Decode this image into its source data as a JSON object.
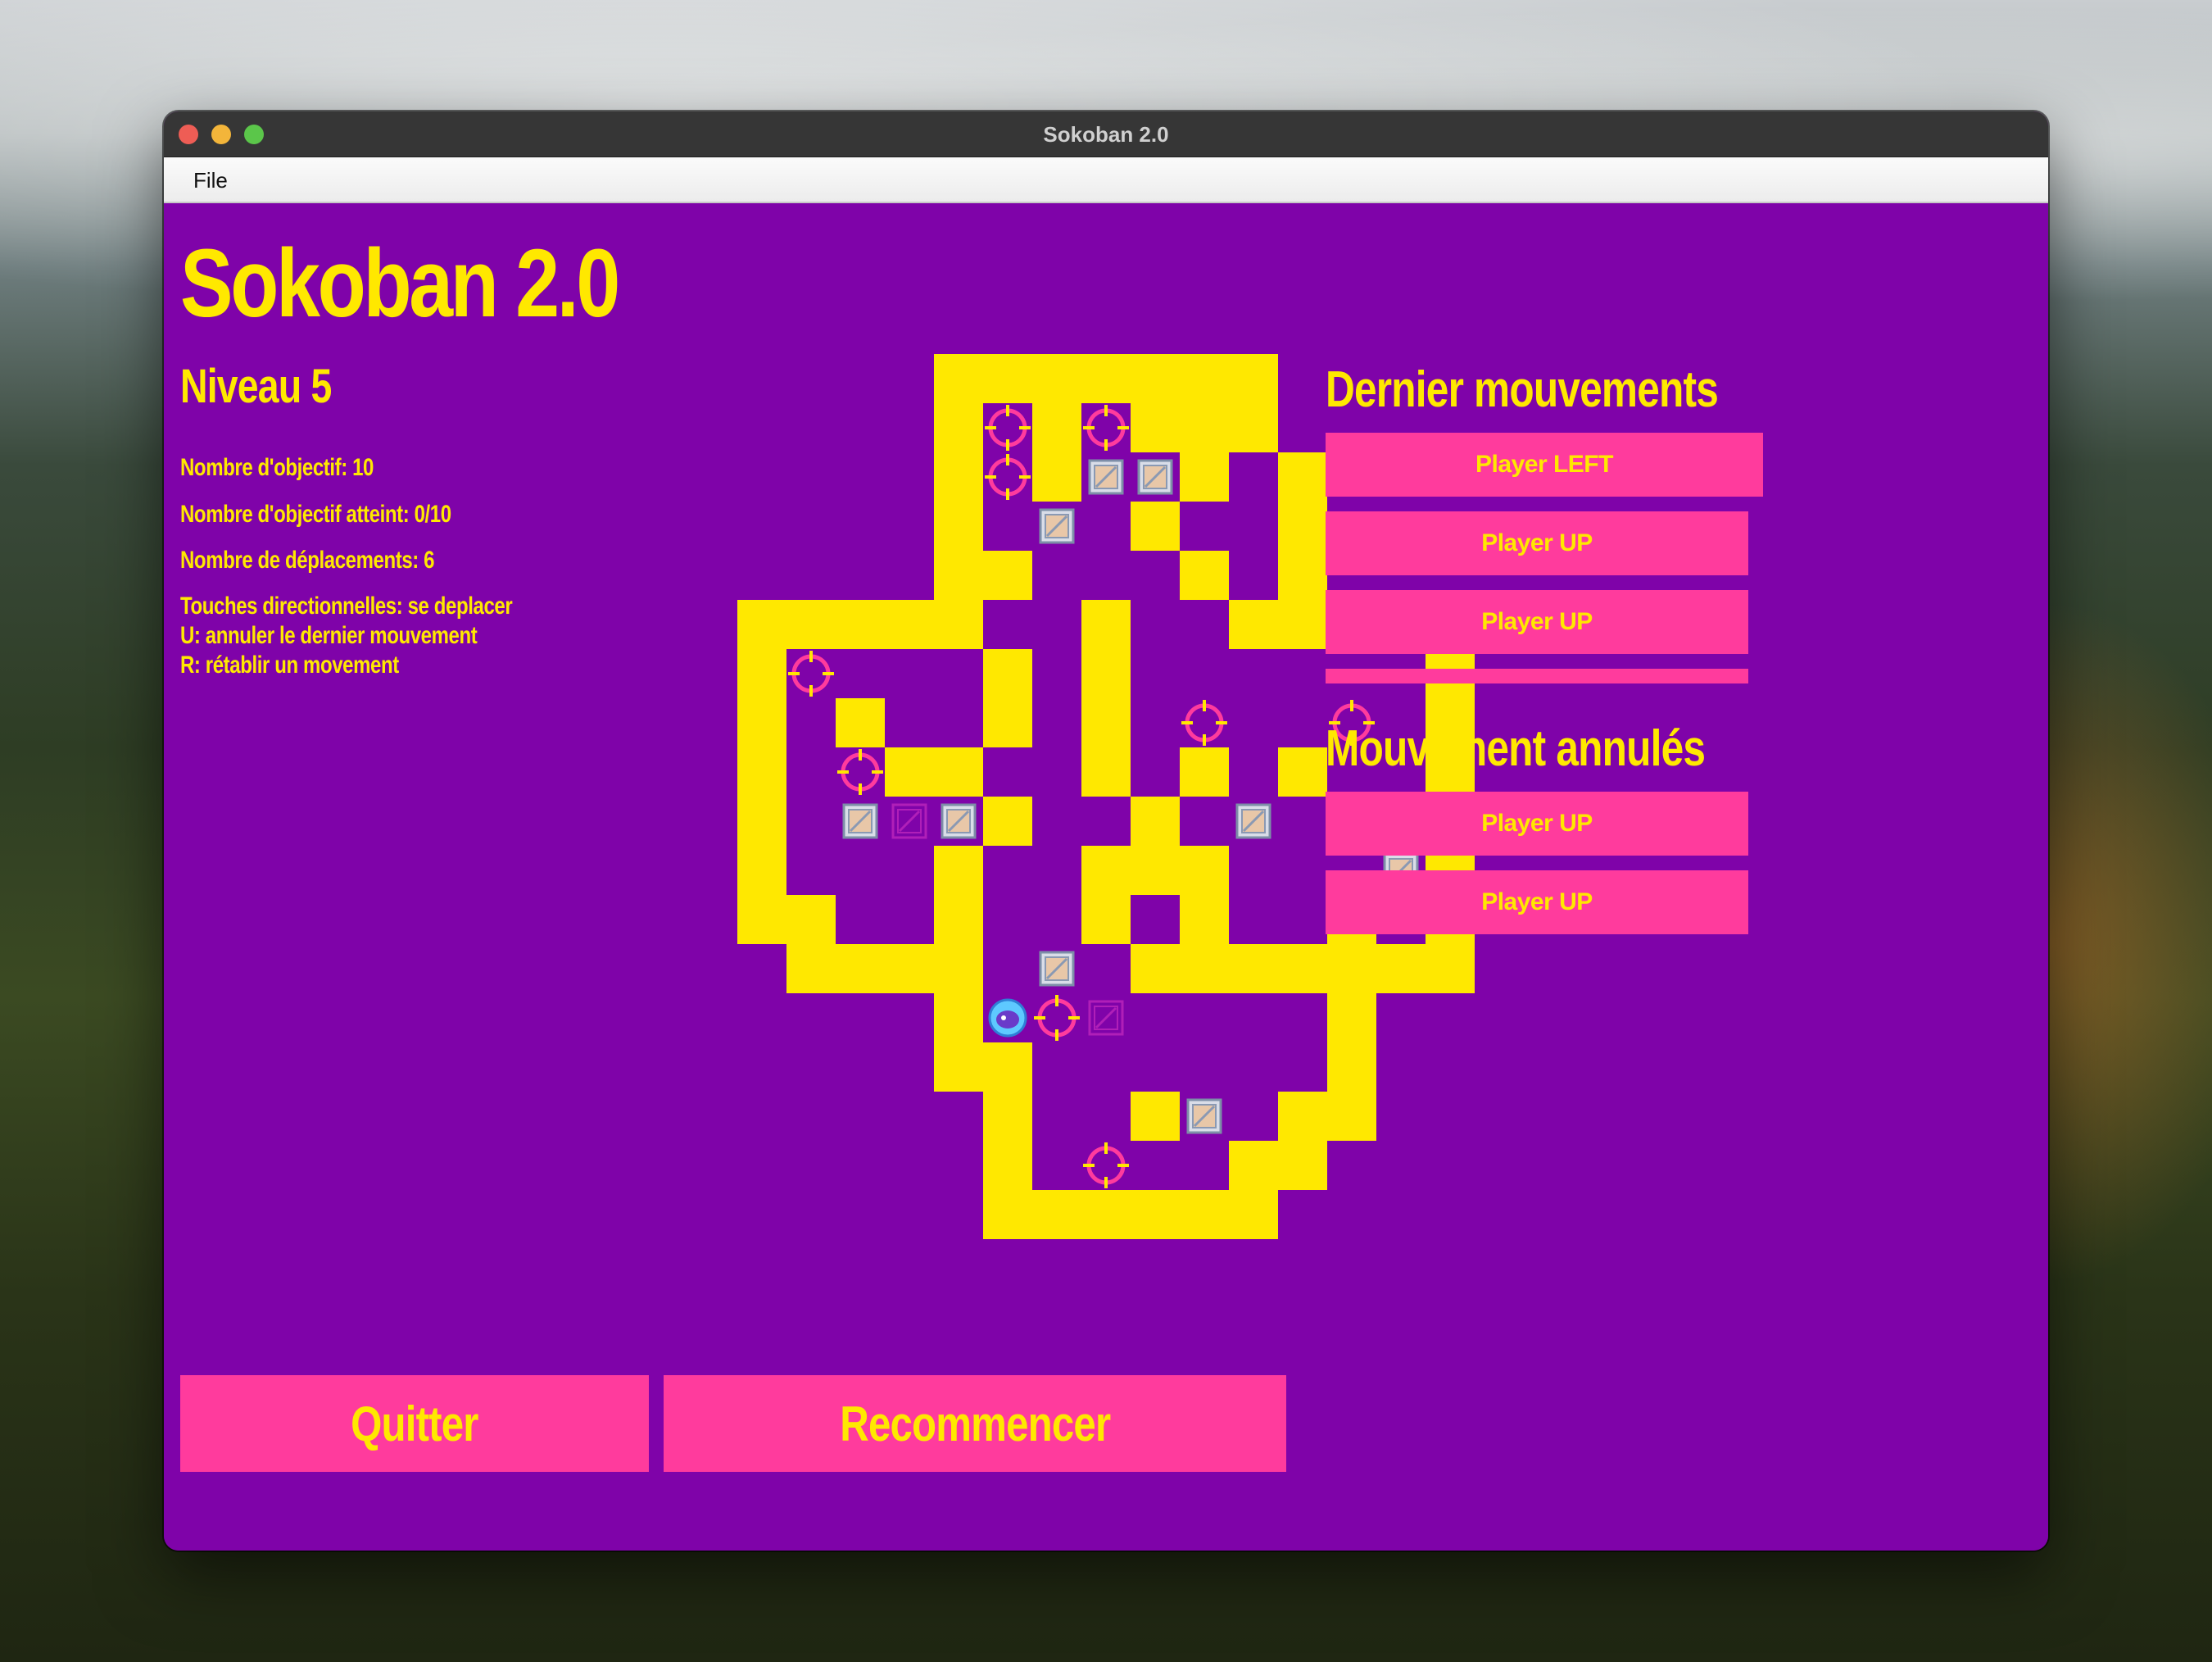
{
  "window": {
    "title": "Sokoban 2.0"
  },
  "menubar": {
    "file_label": "File"
  },
  "game": {
    "title": "Sokoban 2.0",
    "level": "Niveau 5",
    "objectives": "Nombre d'objectif: 10",
    "objectives_reached": "Nombre d'objectif atteint: 0/10",
    "moves": "Nombre de déplacements: 6",
    "help_arrows": "Touches directionnelles: se deplacer",
    "help_undo": "U: annuler le dernier mouvement",
    "help_redo": "R: rétablir un movement"
  },
  "history": {
    "title": "Dernier mouvements",
    "items": [
      "Player LEFT",
      "Player UP",
      "Player UP"
    ]
  },
  "undone": {
    "title": "Mouvement annulés",
    "items": [
      "Player UP",
      "Player UP"
    ]
  },
  "buttons": {
    "quit": "Quitter",
    "restart": "Recommencer"
  },
  "colors": {
    "background": "#7f03a9",
    "wall": "#ffe800",
    "accent": "#ff3b9d",
    "text": "#ffe800"
  },
  "board_map": [
    "....XXXXXXX...",
    "....XgXgXXX...",
    "....XgXBBX.X..",
    "....X.B.X..X..",
    "....XX...X.X..",
    "XXXXX..X..XXXXX",
    "Xg...X.X......X",
    "X.X..X.X.g..g.X",
    "X.gXX..X.X.X..X",
    "X.BbBX..X.B..Bg",
    "X...X..XXX...BX",
    "XX..X..X.X..X.X",
    ".XXXX.B.XXXXXXX",
    "....X@gb....X..",
    "....XX......X..",
    ".....X..XB.XX..",
    ".....X.g..XX...",
    ".....XXXXXX...."
  ]
}
